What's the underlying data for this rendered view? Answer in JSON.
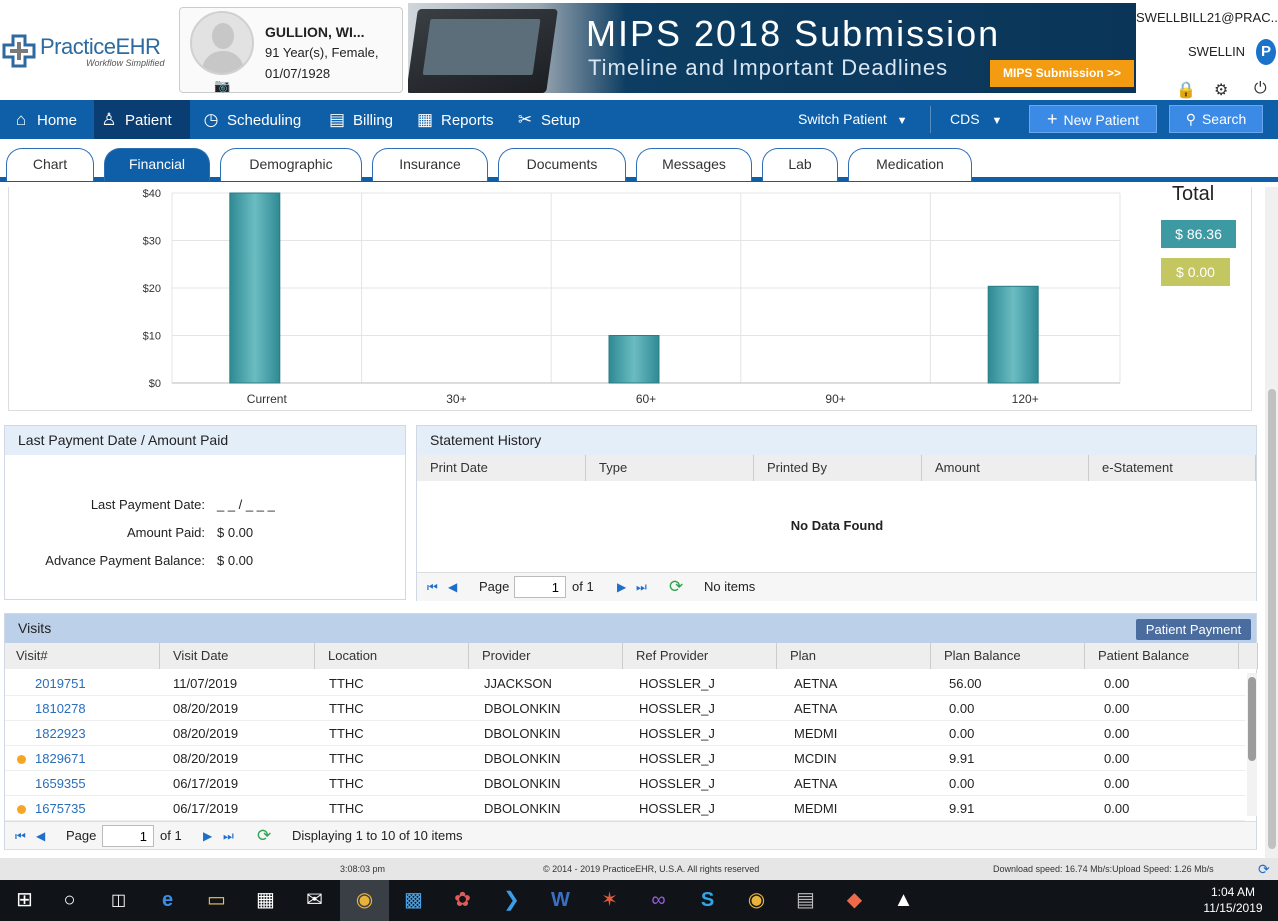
{
  "app": {
    "logo_text": "PracticeEHR",
    "logo_tagline": "Workflow Simplified"
  },
  "patient": {
    "name": "GULLION, WI...",
    "age_line": "91 Year(s), Female,",
    "dob": "01/07/1928"
  },
  "banner": {
    "line1": "MIPS 2018 Submission",
    "line2": "Timeline and Important Deadlines",
    "button": "MIPS Submission >>"
  },
  "user": {
    "email": "SWELLBILL21@PRAC...",
    "username": "SWELLIN",
    "badge": "P"
  },
  "nav": {
    "items": [
      {
        "label": "Home",
        "icon": "home-icon",
        "glyph": "⌂"
      },
      {
        "label": "Patient",
        "icon": "patient-icon",
        "glyph": "♙"
      },
      {
        "label": "Scheduling",
        "icon": "clock-icon",
        "glyph": "◷"
      },
      {
        "label": "Billing",
        "icon": "billing-icon",
        "glyph": "▤"
      },
      {
        "label": "Reports",
        "icon": "reports-icon",
        "glyph": "▦"
      },
      {
        "label": "Setup",
        "icon": "setup-icon",
        "glyph": "✂"
      }
    ],
    "switch_patient": "Switch Patient",
    "cds": "CDS",
    "new_patient": "New Patient",
    "search": "Search"
  },
  "tabs": [
    "Chart",
    "Financial",
    "Demographic",
    "Insurance",
    "Documents",
    "Messages",
    "Lab",
    "Medication"
  ],
  "active_tab": "Financial",
  "chart_data": {
    "type": "bar",
    "categories": [
      "Current",
      "30+",
      "60+",
      "90+",
      "120+"
    ],
    "values": [
      40,
      0,
      10,
      0,
      20.36
    ],
    "yticks": [
      "$0",
      "$10",
      "$20",
      "$30",
      "$40"
    ],
    "ylim": [
      0,
      40
    ],
    "color": "#3d9aa3",
    "grid": true
  },
  "totals": {
    "title": "Total",
    "patient_total": "$ 86.36",
    "other_total": "$ 0.00"
  },
  "last_payment": {
    "title": "Last Payment Date / Amount Paid",
    "date_label": "Last Payment Date:",
    "date_value": "_ _ / _ _ _",
    "amount_label": "Amount Paid:",
    "amount_value": "$ 0.00",
    "advance_label": "Advance Payment Balance:",
    "advance_value": "$ 0.00"
  },
  "statement_history": {
    "title": "Statement History",
    "columns": [
      "Print Date",
      "Type",
      "Printed By",
      "Amount",
      "e-Statement"
    ],
    "empty": "No Data Found",
    "pager": {
      "page_label": "Page",
      "page": "1",
      "of": "of 1",
      "status": "No items"
    }
  },
  "visits": {
    "title": "Visits",
    "payment_button": "Patient Payment",
    "columns": [
      "Visit#",
      "Visit Date",
      "Location",
      "Provider",
      "Ref Provider",
      "Plan",
      "Plan Balance",
      "Patient Balance"
    ],
    "rows": [
      {
        "flag": false,
        "cells": [
          "2019751",
          "11/07/2019",
          "TTHC",
          "JJACKSON",
          "HOSSLER_J",
          "AETNA",
          "56.00",
          "0.00"
        ]
      },
      {
        "flag": false,
        "cells": [
          "1810278",
          "08/20/2019",
          "TTHC",
          "DBOLONKIN",
          "HOSSLER_J",
          "AETNA",
          "0.00",
          "0.00"
        ]
      },
      {
        "flag": false,
        "cells": [
          "1822923",
          "08/20/2019",
          "TTHC",
          "DBOLONKIN",
          "HOSSLER_J",
          "MEDMI",
          "0.00",
          "0.00"
        ]
      },
      {
        "flag": true,
        "cells": [
          "1829671",
          "08/20/2019",
          "TTHC",
          "DBOLONKIN",
          "HOSSLER_J",
          "MCDIN",
          "9.91",
          "0.00"
        ]
      },
      {
        "flag": false,
        "cells": [
          "1659355",
          "06/17/2019",
          "TTHC",
          "DBOLONKIN",
          "HOSSLER_J",
          "AETNA",
          "0.00",
          "0.00"
        ]
      },
      {
        "flag": true,
        "cells": [
          "1675735",
          "06/17/2019",
          "TTHC",
          "DBOLONKIN",
          "HOSSLER_J",
          "MEDMI",
          "9.91",
          "0.00"
        ]
      }
    ],
    "pager": {
      "page_label": "Page",
      "page": "1",
      "of": "of 1",
      "status": "Displaying 1 to 10 of 10 items"
    }
  },
  "footer": {
    "time": "3:08:03 pm",
    "copyright": "© 2014 - 2019 PracticeEHR, U.S.A. All rights reserved",
    "speed": "Download speed: 16.74 Mb/s:Upload Speed: 1.26 Mb/s"
  },
  "taskbar": {
    "clock_time": "1:04 AM",
    "clock_date": "11/15/2019",
    "apps": [
      "start-icon",
      "cortana-icon",
      "task-view-icon",
      "edge-icon",
      "file-explorer-icon",
      "store-icon",
      "mail-icon",
      "chrome-icon",
      "outlook-icon",
      "paint-icon",
      "vscode-icon",
      "word-icon",
      "filezilla-icon",
      "visual-studio-icon",
      "skype-icon",
      "chrome-icon",
      "network-icon",
      "git-icon",
      "photos-icon"
    ]
  }
}
